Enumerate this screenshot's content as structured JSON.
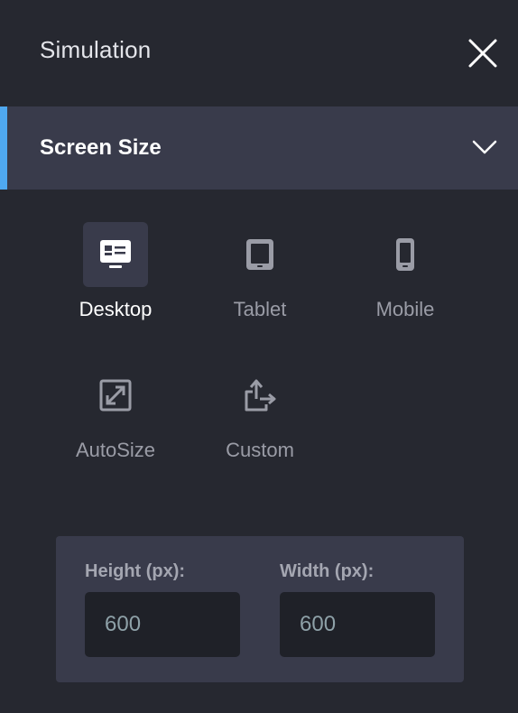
{
  "header": {
    "title": "Simulation"
  },
  "section": {
    "title": "Screen Size"
  },
  "sizes": [
    {
      "label": "Desktop",
      "icon": "desktop-icon",
      "active": true
    },
    {
      "label": "Tablet",
      "icon": "tablet-icon",
      "active": false
    },
    {
      "label": "Mobile",
      "icon": "mobile-icon",
      "active": false
    },
    {
      "label": "AutoSize",
      "icon": "autosize-icon",
      "active": false
    },
    {
      "label": "Custom",
      "icon": "custom-icon",
      "active": false
    }
  ],
  "dimensions": {
    "height_label": "Height (px):",
    "height_value": "600",
    "width_label": "Width (px):",
    "width_value": "600"
  },
  "colors": {
    "background": "#262830",
    "section_bg": "#393b4b",
    "accent": "#4fa8f0",
    "input_bg": "#1f2128"
  }
}
